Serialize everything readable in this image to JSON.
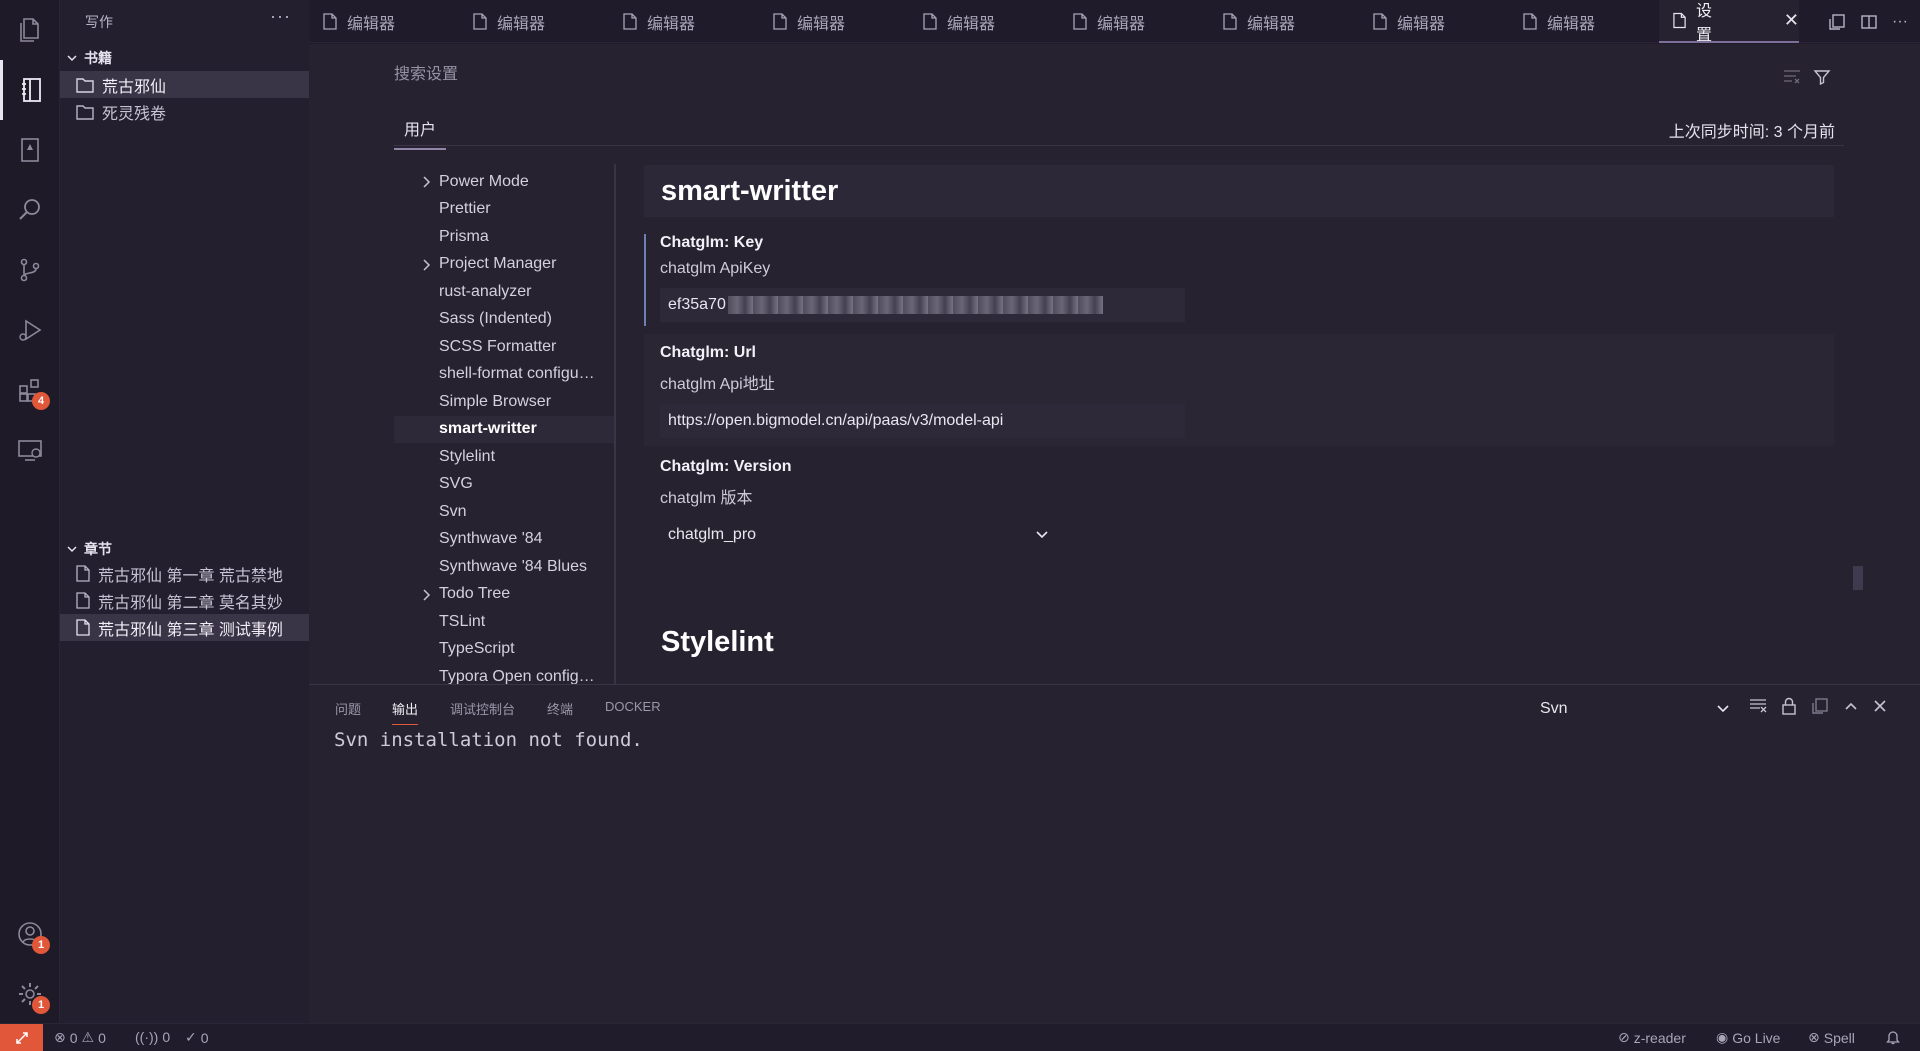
{
  "sidebar": {
    "title": "写作",
    "more": "···",
    "bookshelf": {
      "label": "书籍",
      "items": [
        "荒古邪仙",
        "死灵残卷"
      ]
    },
    "chapters": {
      "label": "章节",
      "items": [
        "荒古邪仙 第一章 荒古禁地",
        "荒古邪仙 第二章 莫名其妙",
        "荒古邪仙 第三章 测试事例"
      ]
    }
  },
  "activity": {
    "extensions_badge": "4",
    "accounts_badge": "1",
    "settings_badge": "1"
  },
  "tabs": {
    "items": [
      "编辑器",
      "编辑器",
      "编辑器",
      "编辑器",
      "编辑器",
      "编辑器",
      "编辑器",
      "编辑器",
      "编辑器"
    ],
    "active": "设置"
  },
  "settings": {
    "search_placeholder": "搜索设置",
    "scope_tab": "用户",
    "sync_text": "上次同步时间: 3 个月前",
    "toc": [
      {
        "label": "Power Mode",
        "chevron": true
      },
      {
        "label": "Prettier"
      },
      {
        "label": "Prisma"
      },
      {
        "label": "Project Manager",
        "chevron": true
      },
      {
        "label": "rust-analyzer"
      },
      {
        "label": "Sass (Indented)"
      },
      {
        "label": "SCSS Formatter"
      },
      {
        "label": "shell-format configu…"
      },
      {
        "label": "Simple Browser"
      },
      {
        "label": "smart-writter",
        "current": true
      },
      {
        "label": "Stylelint"
      },
      {
        "label": "SVG"
      },
      {
        "label": "Svn"
      },
      {
        "label": "Synthwave '84"
      },
      {
        "label": "Synthwave '84 Blues"
      },
      {
        "label": "Todo Tree",
        "chevron": true
      },
      {
        "label": "TSLint"
      },
      {
        "label": "TypeScript"
      },
      {
        "label": "Typora Open config…"
      }
    ],
    "group_title": "smart-writter",
    "key": {
      "title": "Chatglm: Key",
      "desc": "chatglm ApiKey",
      "value_prefix": "ef35a70"
    },
    "url": {
      "title": "Chatglm: Url",
      "desc": "chatglm Api地址",
      "value": "https://open.bigmodel.cn/api/paas/v3/model-api"
    },
    "version": {
      "title": "Chatglm: Version",
      "desc": "chatglm 版本",
      "value": "chatglm_pro"
    },
    "next_group_title": "Stylelint"
  },
  "panel": {
    "tabs": [
      "问题",
      "输出",
      "调试控制台",
      "终端",
      "DOCKER"
    ],
    "active_tab": "输出",
    "channel": "Svn",
    "output": "Svn installation not found."
  },
  "statusbar": {
    "errors": "0",
    "warnings": "0",
    "ports": "0",
    "checks": "0",
    "zreader": "z-reader",
    "golive": "Go Live",
    "spell": "Spell"
  },
  "colors": {
    "accent": "#e0573a",
    "background": "#1f1b2a",
    "editor": "#26222f"
  }
}
